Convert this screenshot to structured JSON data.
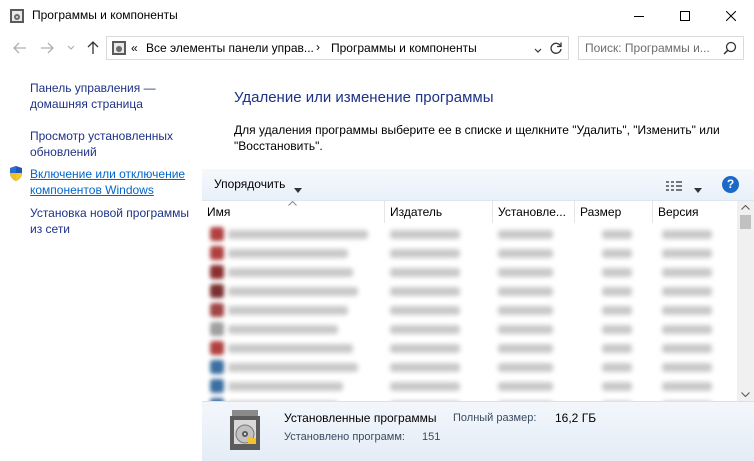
{
  "window": {
    "title": "Программы и компоненты",
    "icon": "control-panel-icon"
  },
  "address": {
    "overflow": "«",
    "segments": [
      "Все элементы панели управ...",
      "Программы и компоненты"
    ]
  },
  "search": {
    "placeholder": "Поиск: Программы и..."
  },
  "sidebar": {
    "items": [
      {
        "label": "Панель управления — домашняя страница"
      },
      {
        "label": "Просмотр установленных обновлений"
      },
      {
        "label": "Включение или отключение компонентов Windows",
        "icon": "shield-icon"
      },
      {
        "label": "Установка новой программы из сети"
      }
    ]
  },
  "main": {
    "heading": "Удаление или изменение программы",
    "instructions": "Для удаления программы выберите ее в списке и щелкните \"Удалить\", \"Изменить\" или \"Восстановить\"."
  },
  "toolbar": {
    "organize_label": "Упорядочить",
    "help_label": "?"
  },
  "columns": [
    "Имя",
    "Издатель",
    "Установле...",
    "Размер",
    "Версия"
  ],
  "details": {
    "title": "Установленные программы",
    "size_label": "Полный размер:",
    "size_value": "16,2 ГБ",
    "count_label": "Установлено программ:",
    "count_value": "151"
  },
  "colors": {
    "link": "#1e3287",
    "toolbar_bg": "#eef3fa",
    "accent": "#1b6ac9"
  }
}
